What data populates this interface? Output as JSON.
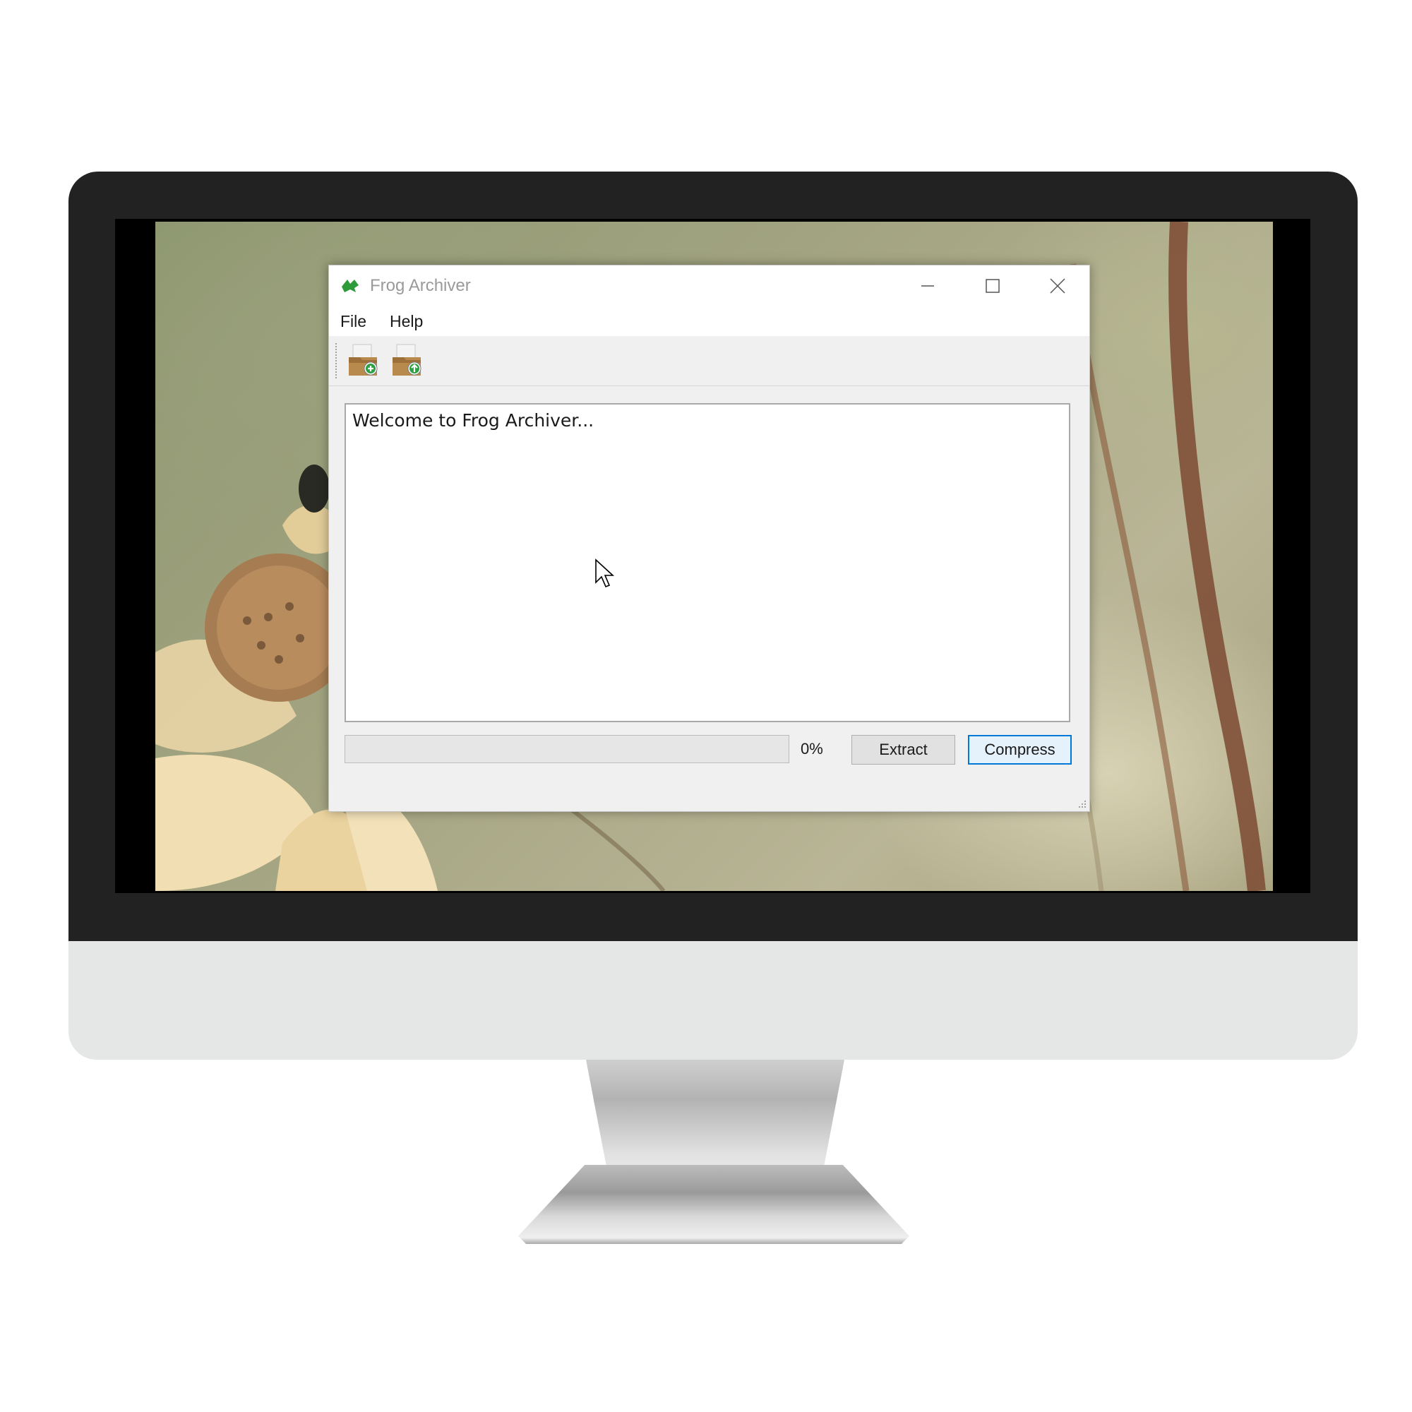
{
  "window": {
    "title": "Frog Archiver",
    "controls": [
      "minimize",
      "maximize",
      "close"
    ]
  },
  "menu": {
    "file": "File",
    "help": "Help"
  },
  "toolbar": {
    "icons": [
      "archive-add-icon",
      "archive-extract-icon"
    ]
  },
  "log": {
    "text": "Welcome to Frog Archiver..."
  },
  "progress": {
    "value": 0,
    "label": "0%"
  },
  "buttons": {
    "extract": "Extract",
    "compress": "Compress"
  },
  "colors": {
    "accent": "#0078d7",
    "app_icon": "#2e9b3a",
    "progress_fill": "#06b025"
  }
}
